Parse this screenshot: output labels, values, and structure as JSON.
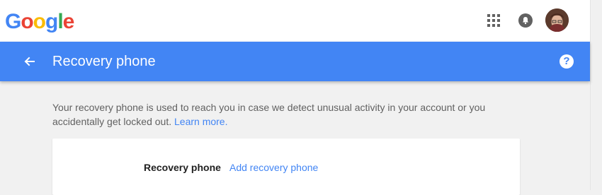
{
  "app": {
    "logo_letters": [
      "G",
      "o",
      "o",
      "g",
      "l",
      "e"
    ]
  },
  "header": {
    "title": "Recovery phone"
  },
  "description": {
    "text": "Your recovery phone is used to reach you in case we detect unusual activity in your account or you accidentally get locked out.",
    "link": "Learn more."
  },
  "card": {
    "label": "Recovery phone",
    "action": "Add recovery phone"
  },
  "icons": {
    "apps": "apps-grid-icon",
    "notifications": "bell-icon",
    "back": "arrow-back-icon",
    "help": "help-icon"
  },
  "colors": {
    "brand_blue": "#4285f4",
    "background": "#f1f1f1",
    "text_secondary": "#616161"
  }
}
